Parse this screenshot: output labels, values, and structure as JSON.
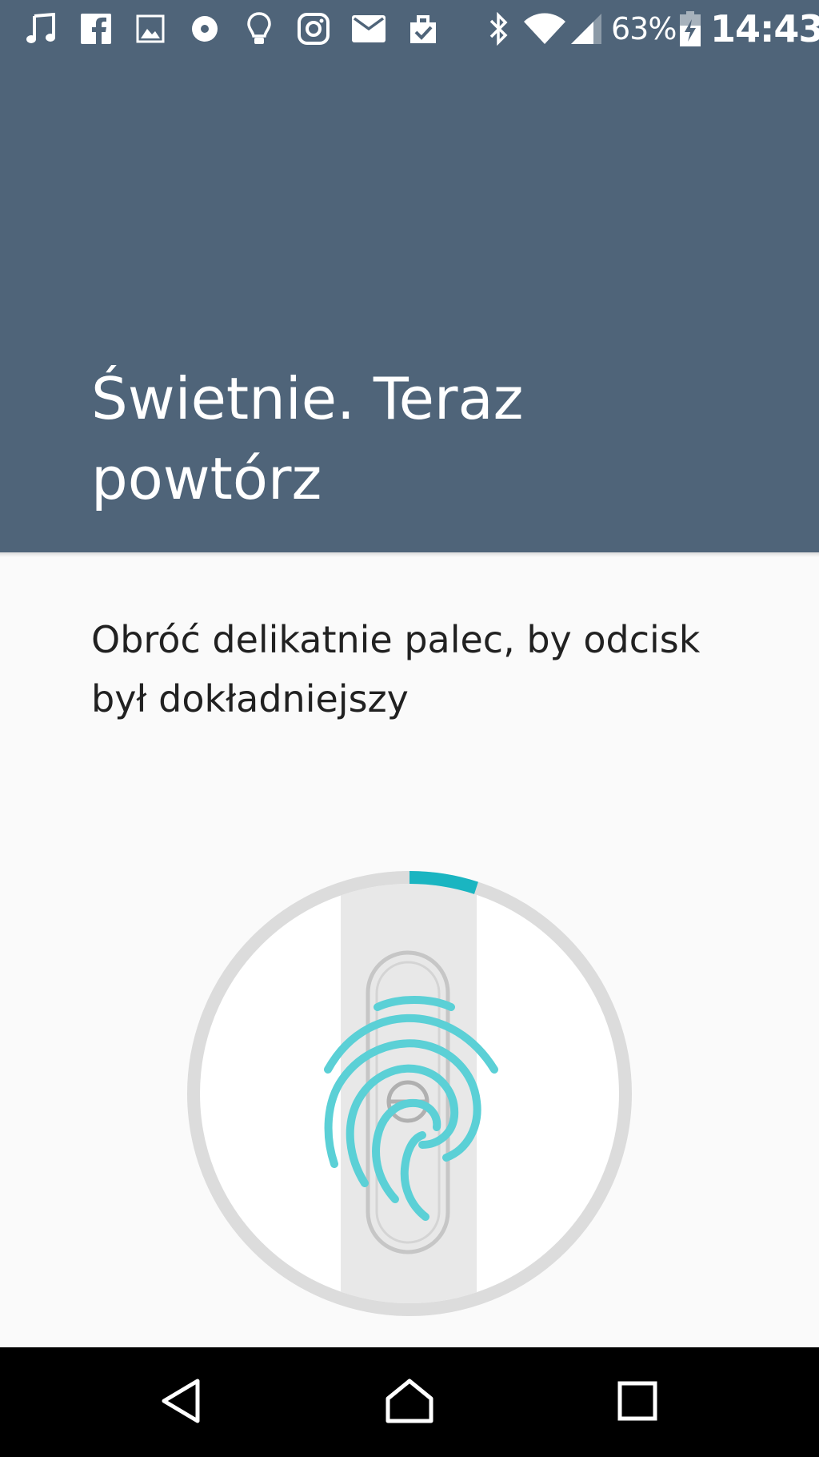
{
  "status_bar": {
    "notification_icons": [
      "music-note-icon",
      "facebook-icon",
      "image-icon",
      "disc-icon",
      "lightbulb-icon",
      "instagram-icon",
      "mail-icon",
      "clipboard-check-icon"
    ],
    "system_icons": [
      "bluetooth-icon",
      "wifi-icon",
      "cellular-signal-icon",
      "battery-charging-icon"
    ],
    "battery_percent": "63%",
    "time": "14:43"
  },
  "header": {
    "title": "Świetnie. Teraz powtórz",
    "background_color": "#4f6479"
  },
  "main": {
    "instruction": "Obróć delikatnie palec, by odcisk był dokładniejszy"
  },
  "enrollment": {
    "progress": 0.05,
    "accent_color": "#1ab5c1",
    "icon": "fingerprint-icon",
    "sensor_icon": "fingerprint-sensor-icon"
  },
  "nav_bar": {
    "buttons": [
      "back-icon",
      "home-icon",
      "recents-icon"
    ]
  }
}
